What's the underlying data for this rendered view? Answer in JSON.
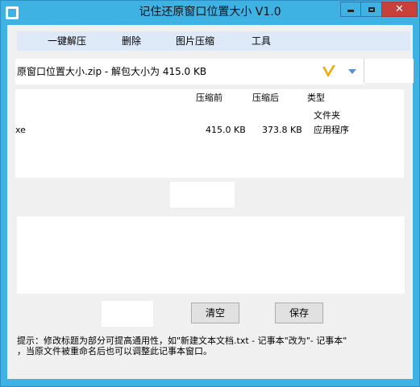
{
  "window": {
    "title": "记住还原窗口位置大小 V1.0",
    "controls": {
      "minimize": "",
      "maximize": "",
      "close": "✕"
    }
  },
  "menu": {
    "items": [
      {
        "label": "一键解压"
      },
      {
        "label": "删除"
      },
      {
        "label": "图片压缩"
      },
      {
        "label": "工具"
      }
    ]
  },
  "archive_combo": {
    "value": "原窗口位置大小.zip - 解包大小为 415.0 KB",
    "icon": "v-logo-icon",
    "accent": "#f5a800"
  },
  "file_list": {
    "columns": [
      "压缩前",
      "压缩后",
      "类型"
    ],
    "rows": [
      {
        "name": "",
        "before": "",
        "after": "",
        "type": "文件夹"
      },
      {
        "name": "xe",
        "before": "415.0 KB",
        "after": "373.8 KB",
        "type": "应用程序"
      }
    ]
  },
  "buttons": {
    "clear": "清空",
    "save": "保存"
  },
  "hint": {
    "line1": "提示：修改标题为部分可提高通用性，如\"新建文本文档.txt - 记事本\"改为\"- 记事本\"",
    "line2": "，当原文件被重命名后也可以调整此记事本窗口。"
  }
}
